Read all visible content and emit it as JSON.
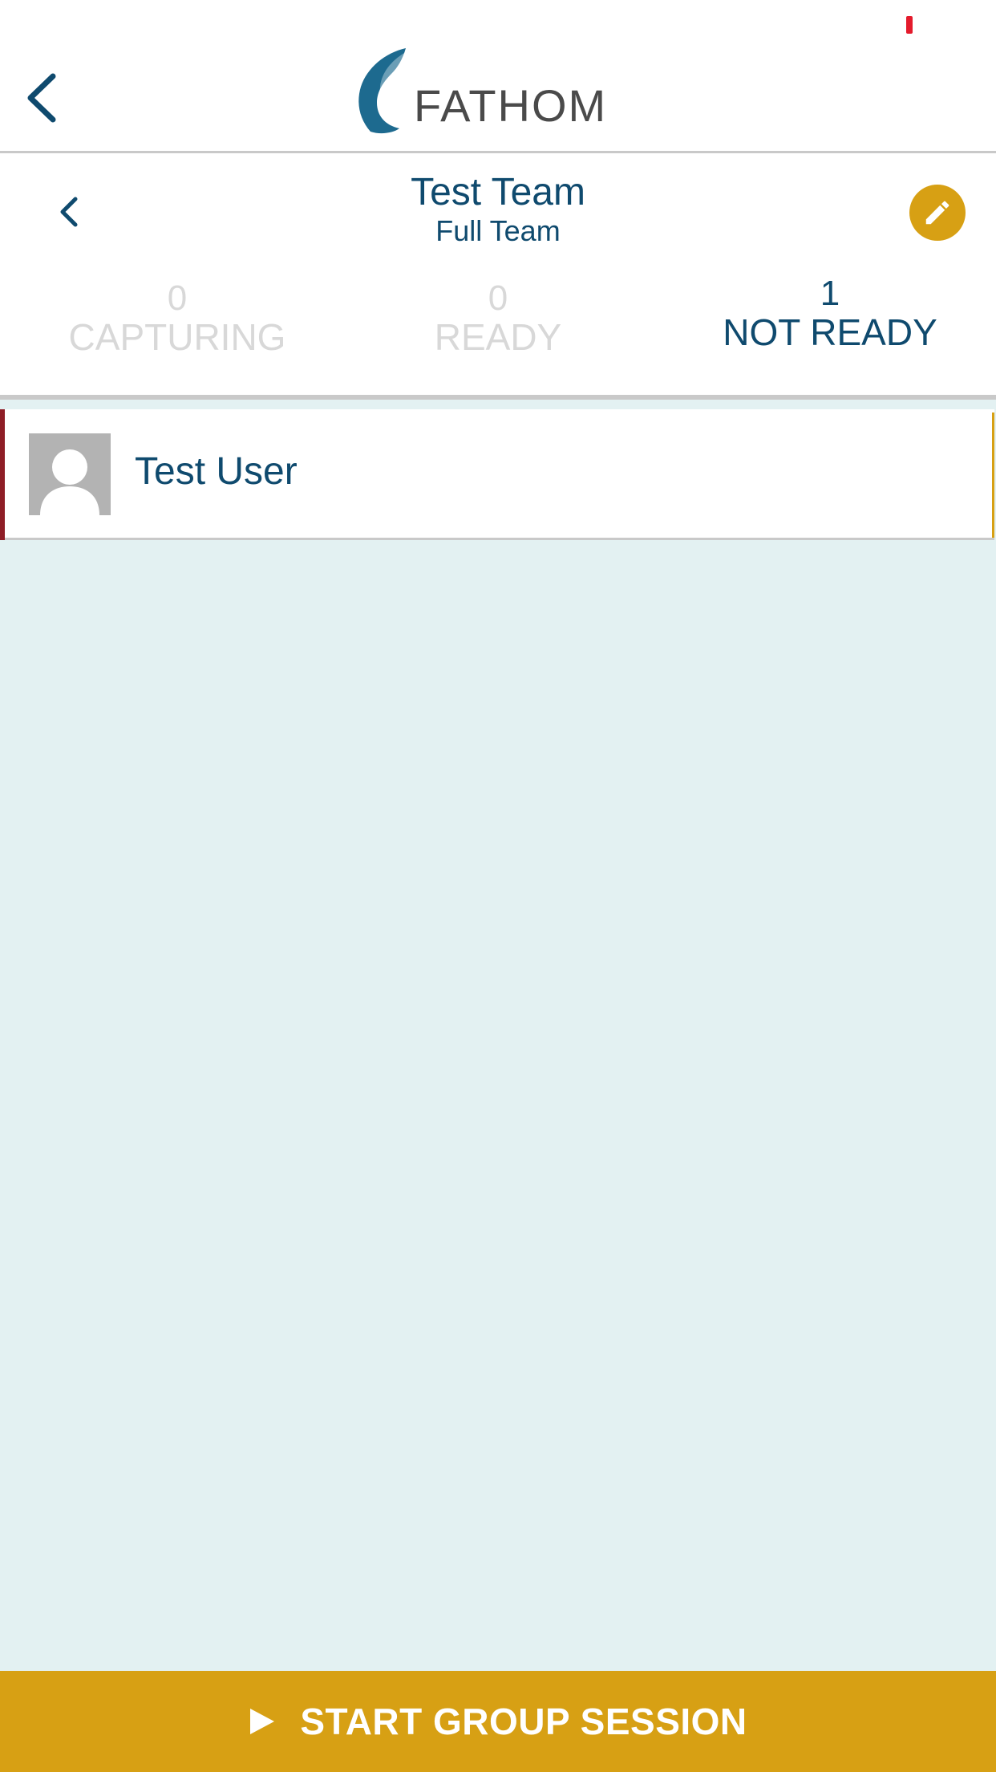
{
  "colors": {
    "primary": "#0f4a6e",
    "accent": "#d7a014",
    "status_red": "#e41b2c",
    "not_ready_accent": "#8e1d26",
    "background": "#e3f1f2"
  },
  "header": {
    "logo_text": "FATHOM",
    "back_icon": "chevron-left-icon"
  },
  "team": {
    "title": "Test Team",
    "subtitle": "Full Team",
    "back_icon": "chevron-left-icon",
    "edit_icon": "pencil-icon"
  },
  "stats": [
    {
      "count": "0",
      "label": "CAPTURING",
      "active": false
    },
    {
      "count": "0",
      "label": "READY",
      "active": false
    },
    {
      "count": "1",
      "label": "NOT READY",
      "active": true
    }
  ],
  "members": [
    {
      "name": "Test User",
      "avatar_icon": "default-user-avatar-icon"
    }
  ],
  "action": {
    "label": "START GROUP SESSION",
    "icon": "play-icon"
  }
}
